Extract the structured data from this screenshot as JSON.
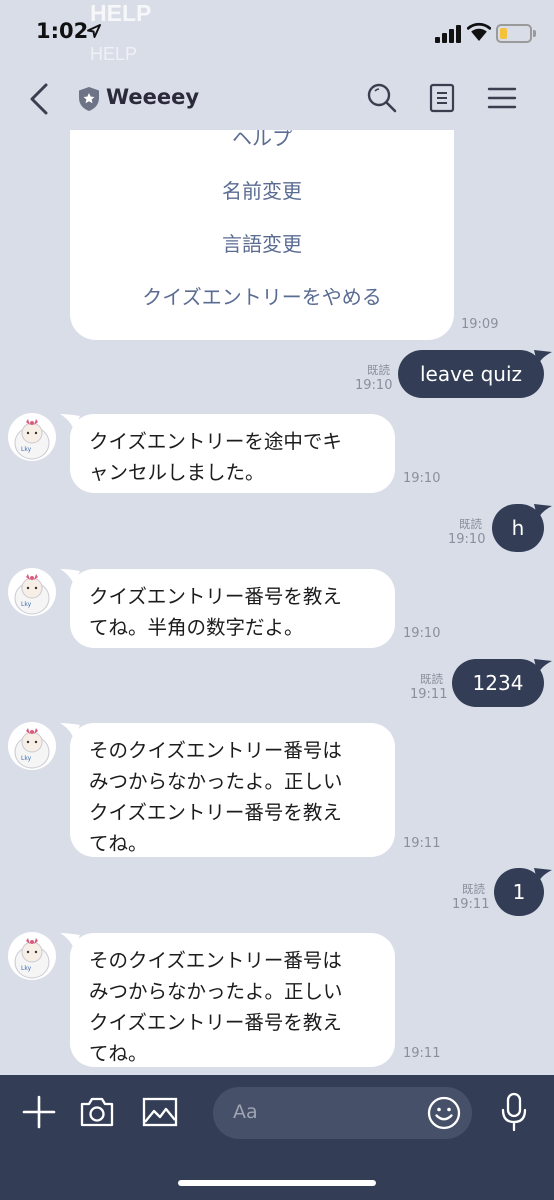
{
  "status_bar": {
    "time": "1:02",
    "ghost_text_1": "HELP",
    "ghost_text_2": "HELP",
    "battery_level": 0.25,
    "battery_color": "#f4c13a"
  },
  "header": {
    "title": "Weeeey",
    "back_icon": "chevron-left-icon",
    "shield_icon": "shield-star-icon",
    "actions": [
      "search-icon",
      "notes-icon",
      "menu-icon"
    ]
  },
  "menu_card": {
    "items": [
      "ヘルプ",
      "名前変更",
      "言語変更",
      "クイズエントリーをやめる"
    ],
    "time": "19:09"
  },
  "messages": [
    {
      "direction": "out",
      "text": "leave quiz",
      "read": "既読",
      "time": "19:10"
    },
    {
      "direction": "in",
      "lines": [
        "クイズエントリーを途中でキ",
        "ャンセルしました。"
      ],
      "time": "19:10"
    },
    {
      "direction": "out",
      "text": "h",
      "read": "既読",
      "time": "19:10"
    },
    {
      "direction": "in",
      "lines": [
        "クイズエントリー番号を教え",
        "てね。半角の数字だよ。"
      ],
      "time": "19:10"
    },
    {
      "direction": "out",
      "text": "1234",
      "read": "既読",
      "time": "19:11"
    },
    {
      "direction": "in",
      "lines": [
        "そのクイズエントリー番号は",
        "みつからなかったよ。正しい",
        "クイズエントリー番号を教え",
        "てね。"
      ],
      "time": "19:11"
    },
    {
      "direction": "out",
      "text": "1",
      "read": "既読",
      "time": "19:11"
    },
    {
      "direction": "in",
      "lines": [
        "そのクイズエントリー番号は",
        "みつからなかったよ。正しい",
        "クイズエントリー番号を教え",
        "てね。"
      ],
      "time": "19:11"
    }
  ],
  "input_bar": {
    "placeholder": "Aa",
    "icons": [
      "plus-icon",
      "camera-icon",
      "image-icon",
      "emoji-icon",
      "microphone-icon"
    ]
  },
  "colors": {
    "background": "#d9dde8",
    "outgoing_bubble": "#333d56",
    "incoming_bubble": "#ffffff",
    "menu_link": "#5b6c93",
    "input_bar": "#333d56"
  }
}
